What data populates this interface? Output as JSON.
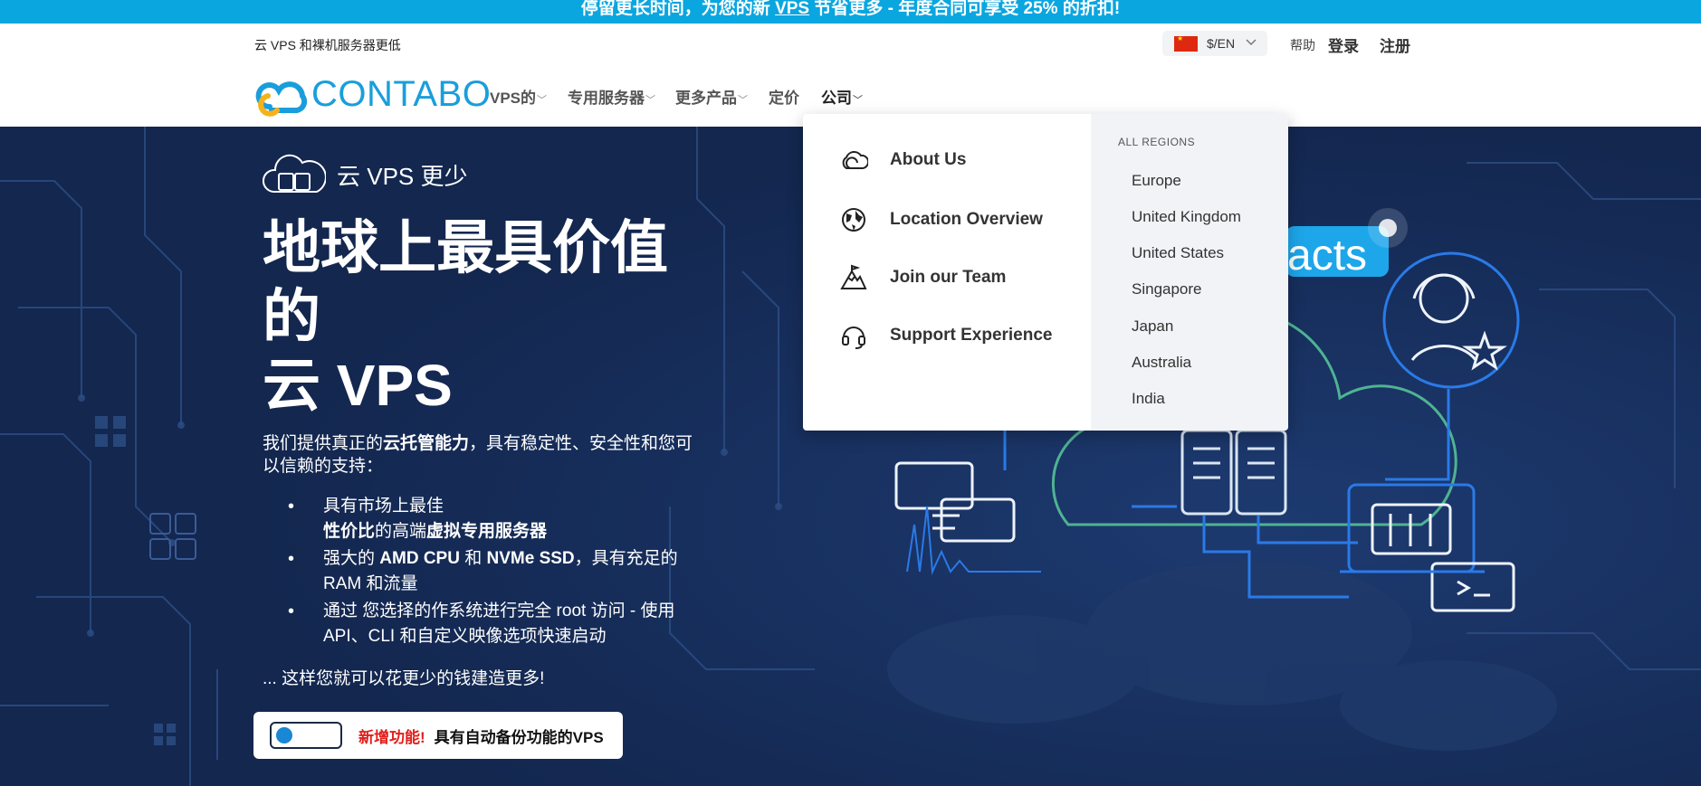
{
  "promo": {
    "part1": "停留更长时间，为您的新 ",
    "highlight": "VPS",
    "part2": " 节省更多 - 年度合同可享受 25% 的折扣!"
  },
  "util": {
    "tagline": "云 VPS 和裸机服务器更低",
    "currency_lang": "$/EN",
    "help": "帮助",
    "login": "登录",
    "register": "注册"
  },
  "nav": {
    "logo": "CONTABO",
    "items": [
      "VPS的",
      "专用服务器",
      "更多产品",
      "定价",
      "公司"
    ]
  },
  "hero": {
    "subheading": "云 VPS 更少",
    "title_l1": "地球上最具价值",
    "title_l2": "的",
    "title_l3": "云 VPS",
    "lead_a": "我们提供真正的",
    "lead_b": "云托管能力",
    "lead_c": "，具有稳定性、安全性和您可以信赖的支持：",
    "bullets": {
      "b1_a": "具有市场上最佳",
      "b1_b": "性价比",
      "b1_c": "的高端",
      "b1_d": "虚拟专用服务器",
      "b2_a": "强大的 ",
      "b2_b": "AMD CPU",
      "b2_c": " 和 ",
      "b2_d": "NVMe SSD",
      "b2_e": "，具有充足的 RAM 和流量",
      "b3": "通过 您选择的作系统进行完全 root 访问 - 使用 API、CLI 和自定义映像选项快速启动"
    },
    "closing": "... 这样您就可以花更少的钱建造更多!",
    "new_label": "新增功能!",
    "new_text": "具有自动备份功能的VPS",
    "bg_text": "acts"
  },
  "dropdown": {
    "items": [
      "About Us",
      "Location Overview",
      "Join our Team",
      "Support Experience"
    ],
    "regions_head": "ALL REGIONS",
    "regions": [
      "Europe",
      "United Kingdom",
      "United States",
      "Singapore",
      "Japan",
      "Australia",
      "India"
    ]
  },
  "colors": {
    "promo_bg": "#0aa6df",
    "hero_bg": "#142a55",
    "brand_blue": "#1a9edb",
    "accent_red": "#e0201c"
  }
}
